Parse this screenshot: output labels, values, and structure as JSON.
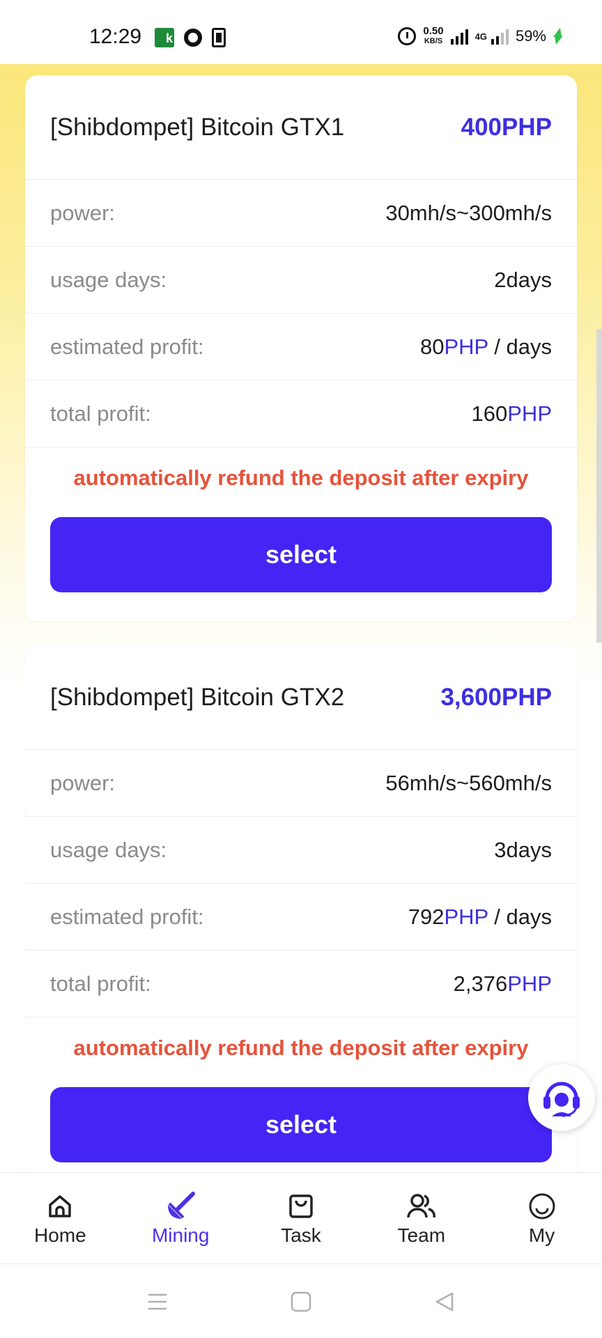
{
  "status_bar": {
    "time": "12:29",
    "net_speed_value": "0.50",
    "net_speed_unit": "KB/S",
    "network_type": "4G",
    "battery": "59%"
  },
  "colors": {
    "accent": "#4425f5",
    "price": "#3d2fe0",
    "notice": "#e5533c",
    "background_top": "#fbe67a"
  },
  "plans": [
    {
      "title": "[Shibdompet] Bitcoin GTX1",
      "price": "400PHP",
      "power_label": "power:",
      "power_value": "30mh/s~300mh/s",
      "days_label": "usage days:",
      "days_value": "2days",
      "est_label": "estimated profit:",
      "est_number": "80",
      "est_currency": "PHP",
      "est_suffix": " / days",
      "total_label": "total profit:",
      "total_number": "160",
      "total_currency": "PHP",
      "notice": "automatically refund the deposit after expiry",
      "button": "select"
    },
    {
      "title": "[Shibdompet] Bitcoin GTX2",
      "price": "3,600PHP",
      "power_label": "power:",
      "power_value": "56mh/s~560mh/s",
      "days_label": "usage days:",
      "days_value": "3days",
      "est_label": "estimated profit:",
      "est_number": "792",
      "est_currency": "PHP",
      "est_suffix": " / days",
      "total_label": "total profit:",
      "total_number": "2,376",
      "total_currency": "PHP",
      "notice": "automatically refund the deposit after expiry",
      "button": "select"
    }
  ],
  "support": {
    "icon": "headset-icon"
  },
  "nav": {
    "items": [
      {
        "label": "Home",
        "icon": "home-icon"
      },
      {
        "label": "Mining",
        "icon": "mining-icon",
        "active": true
      },
      {
        "label": "Task",
        "icon": "task-icon"
      },
      {
        "label": "Team",
        "icon": "team-icon"
      },
      {
        "label": "My",
        "icon": "profile-icon"
      }
    ]
  }
}
